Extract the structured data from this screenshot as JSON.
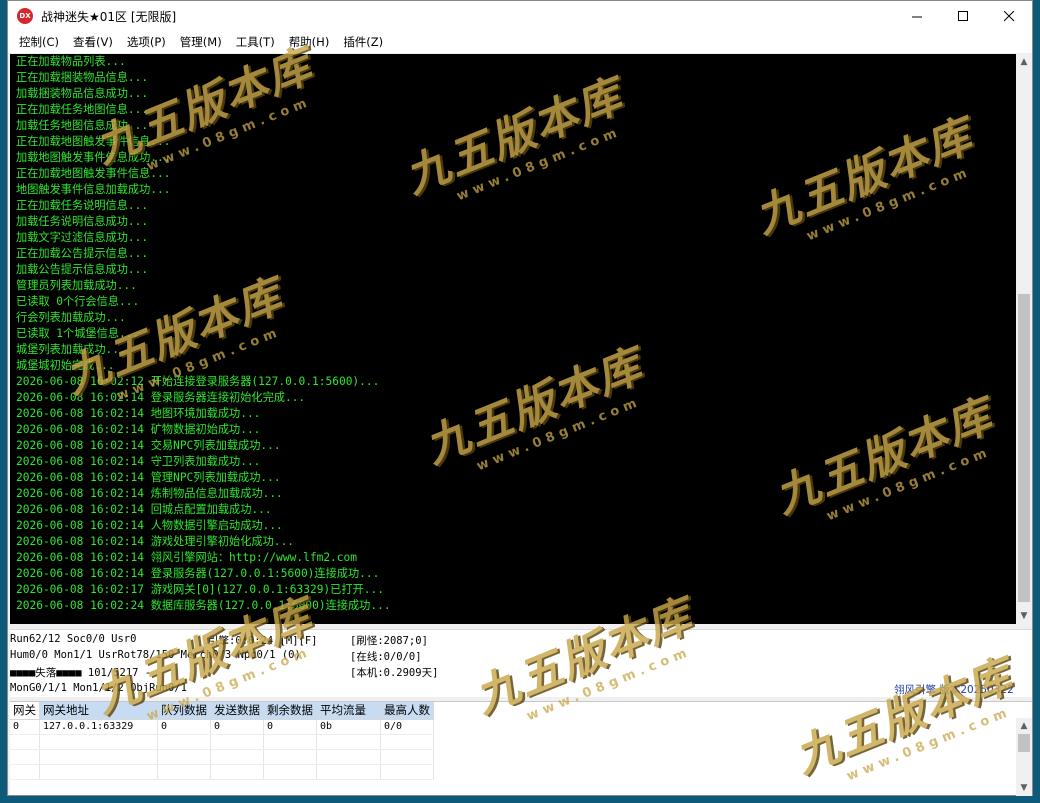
{
  "window": {
    "title": "战神迷失★01区 [无限版]",
    "icon_text": "DX"
  },
  "menu": [
    "控制(C)",
    "查看(V)",
    "选项(P)",
    "管理(M)",
    "工具(T)",
    "帮助(H)",
    "插件(Z)"
  ],
  "console_lines": [
    "正在加载物品列表...",
    "正在加载捆装物品信息...",
    "加载捆装物品信息成功...",
    "正在加载任务地图信息...",
    "加载任务地图信息成功...",
    "正在加载地图触发事件信息...",
    "加载地图触发事件信息成功...",
    "正在加载地图触发事件信息...",
    "地图触发事件信息加载成功...",
    "正在加载任务说明信息...",
    "加载任务说明信息成功...",
    "加载文字过滤信息成功...",
    "正在加载公告提示信息...",
    "加载公告提示信息成功...",
    "管理员列表加载成功...",
    "已读取 0个行会信息...",
    "行会列表加载成功...",
    "已读取 1个城堡信息...",
    "城堡列表加载成功...",
    "城堡城初始完成...",
    "2026-06-08 16:02:12 开始连接登录服务器(127.0.0.1:5600)...",
    "2026-06-08 16:02:14 登录服务器连接初始化完成...",
    "2026-06-08 16:02:14 地图环境加载成功...",
    "2026-06-08 16:02:14 矿物数据初始成功...",
    "2026-06-08 16:02:14 交易NPC列表加载成功...",
    "2026-06-08 16:02:14 守卫列表加载成功...",
    "2026-06-08 16:02:14 管理NPC列表加载成功...",
    "2026-06-08 16:02:14 炼制物品信息加载成功...",
    "2026-06-08 16:02:14 回城点配置加载成功...",
    "2026-06-08 16:02:14 人物数据引擎启动成功...",
    "2026-06-08 16:02:14 游戏处理引擎初始化成功...",
    "2026-06-08 16:02:14 翎风引擎网站：http://www.lfm2.com",
    "2026-06-08 16:02:14 登录服务器(127.0.0.1:5600)连接成功...",
    "2026-06-08 16:02:17 游戏网关[0](127.0.0.1:63329)已打开...",
    "2026-06-08 16:02:24 数据库服务器(127.0.0.1:6000)连接成功..."
  ],
  "status": {
    "line1": "Run62/12 Soc0/0 Usr0",
    "engine": "引擎:0:0:24 [M][F]",
    "refresh": "[刷怪:2087;0]",
    "line2": "Hum0/0 Mon1/1 UsrRot78/150 Merch0/3 Npc0/1 (0)",
    "online": "[在线:0/0/0]",
    "line3": "■■■■失落■■■■ 101/5217 -",
    "machine": "[本机:0.2909天]",
    "line4": "MonG0/1/1 Mon1/1/2 ObjRun0/1",
    "brand": "翎风引擎 版本20250322"
  },
  "gateway": {
    "headers": [
      "网关",
      "网关地址",
      "队列数据",
      "发送数据",
      "剩余数据",
      "平均流量",
      "最高人数"
    ],
    "rows": [
      [
        "0",
        "127.0.0.1:63329",
        "0",
        "0",
        "0",
        "0b",
        "0/0"
      ]
    ]
  },
  "watermark": {
    "text": "九五版本库",
    "url": "www.08gm.com"
  }
}
